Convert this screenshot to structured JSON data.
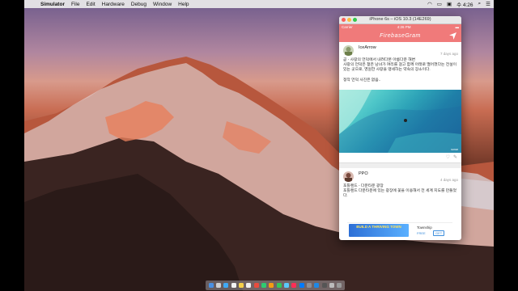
{
  "menubar": {
    "app_name": "Simulator",
    "menus": [
      "File",
      "Edit",
      "Hardware",
      "Debug",
      "Window",
      "Help"
    ],
    "clock": "수 4:26"
  },
  "simulator": {
    "window_title": "iPhone 6s – iOS 10.3 (14E269)",
    "status": {
      "carrier": "Carrier",
      "time": "4:26 PM"
    },
    "nav_title": "FirebaseGram",
    "posts": [
      {
        "username": "IceArrow",
        "time": "7 days ago",
        "text": "곧 - 사랑의 언덕에서 내려다본 아름다운 해변\n사랑의 언덕은 젊은 남녀가 여리를 걸고 함께 아래로 떨어졌다는 전설이 있는 곳으로, 영원한 사랑을 맹세하는 약속의 장소이다.\n\n정작 언덕 사진은 없음..",
        "photo_label": "sonar"
      },
      {
        "username": "PPO",
        "time": "4 days ago",
        "text": "포틀랜드 - 다운타운 광장\n포틀랜드 다운타운에 있는 광장에 꽃을 이용해서 전 세계 지도를 만들었다."
      }
    ],
    "ad": {
      "image_text": "BUILD A THRIVING TOWN",
      "app_name": "Township",
      "price": "FREE",
      "get_label": "GET"
    }
  }
}
